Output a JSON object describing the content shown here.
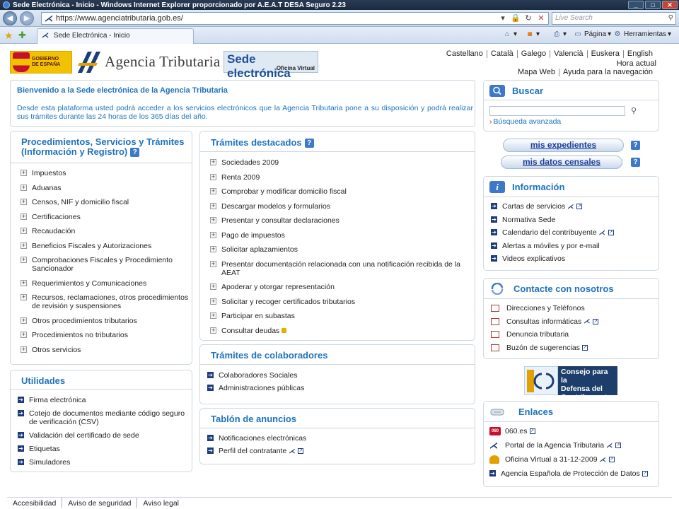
{
  "browser": {
    "window_title": "Sede Electrónica - Inicio - Windows Internet Explorer proporcionado por A.E.A.T DESA Seguro 2.23",
    "url": "https://www.agenciatributaria.gob.es/",
    "search_placeholder": "Live Search",
    "tab_title": "Sede Electrónica - Inicio",
    "tools": {
      "page": "Página",
      "tools": "Herramientas"
    }
  },
  "header": {
    "gob_text_1": "GOBIERNO",
    "gob_text_2": "DE ESPAÑA",
    "aeat_name": "Agencia Tributaria",
    "sede_title": "Sede electrónica",
    "sede_sub": "Oficina Virtual",
    "languages": [
      "Castellano",
      "Català",
      "Galego",
      "Valencià",
      "Euskera",
      "English"
    ],
    "hora_actual": "Hora actual",
    "links": [
      "Mapa Web",
      "Ayuda para la navegación"
    ]
  },
  "welcome": {
    "title": "Bienvenido a la Sede electrónica de la Agencia Tributaria",
    "text": "Desde esta plataforma usted podrá acceder a los servicios electrónicos que la Agencia Tributaria pone a su disposición y podrá realizar sus trámites durante las 24 horas de los 365 días del año."
  },
  "procedimientos": {
    "title": "Procedimientos, Servicios y Trámites (Información y Registro)",
    "items": [
      "Impuestos",
      "Aduanas",
      "Censos, NIF y domicilio fiscal",
      "Certificaciones",
      "Recaudación",
      "Beneficios Fiscales y Autorizaciones",
      "Comprobaciones Fiscales y Procedimiento Sancionador",
      "Requerimientos y Comunicaciones",
      "Recursos, reclamaciones, otros procedimientos de revisión y suspensiones",
      "Otros procedimientos tributarios",
      "Procedimientos no tributarios",
      "Otros servicios"
    ]
  },
  "utilidades": {
    "title": "Utilidades",
    "items": [
      "Firma electrónica",
      "Cotejo de documentos mediante código seguro de verificación (CSV)",
      "Validación del certificado de sede",
      "Etiquetas",
      "Simuladores"
    ]
  },
  "destacados": {
    "title": "Trámites destacados",
    "items": [
      "Sociedades 2009",
      "Renta 2009",
      "Comprobar y modificar domicilio fiscal",
      "Descargar modelos y formularios",
      "Presentar y consultar declaraciones",
      "Pago de impuestos",
      "Solicitar aplazamientos",
      "Presentar documentación relacionada con una notificación recibida de la AEAT",
      "Apoderar y otorgar representación",
      "Solicitar y recoger certificados tributarios",
      "Participar en subastas",
      "Consultar deudas"
    ]
  },
  "colaboradores": {
    "title": "Trámites de colaboradores",
    "items": [
      "Colaboradores Sociales",
      "Administraciones públicas"
    ]
  },
  "tablon": {
    "title": "Tablón de anuncios",
    "items": [
      "Notificaciones electrónicas",
      "Perfil del contratante"
    ]
  },
  "buscar": {
    "title": "Buscar",
    "advanced": "Búsqueda avanzada"
  },
  "pills": {
    "expedientes": "mis expedientes",
    "censales": "mis datos censales"
  },
  "informacion": {
    "title": "Información",
    "items": [
      "Cartas de servicios",
      "Normativa Sede",
      "Calendario del contribuyente",
      "Alertas a móviles y por e-mail",
      "Videos explicativos"
    ]
  },
  "contacte": {
    "title": "Contacte con nosotros",
    "items": [
      "Direcciones y Teléfonos",
      "Consultas informáticas",
      "Denuncia tributaria",
      "Buzón de sugerencias"
    ]
  },
  "consejo": {
    "line1": "Consejo para la",
    "line2": "Defensa del",
    "line3": "Contribuyente"
  },
  "enlaces": {
    "title": "Enlaces",
    "items": [
      "060.es",
      "Portal de la Agencia Tributaria",
      "Oficina Virtual a 31-12-2009",
      "Agencia Española de Protección de Datos"
    ],
    "badge_060": "060"
  },
  "footer": {
    "links": [
      "Accesibilidad",
      "Aviso de seguridad",
      "Aviso legal"
    ]
  },
  "colors": {
    "accent_blue": "#1e73be",
    "navy": "#1d3d7a",
    "border": "#cdd7e3"
  }
}
